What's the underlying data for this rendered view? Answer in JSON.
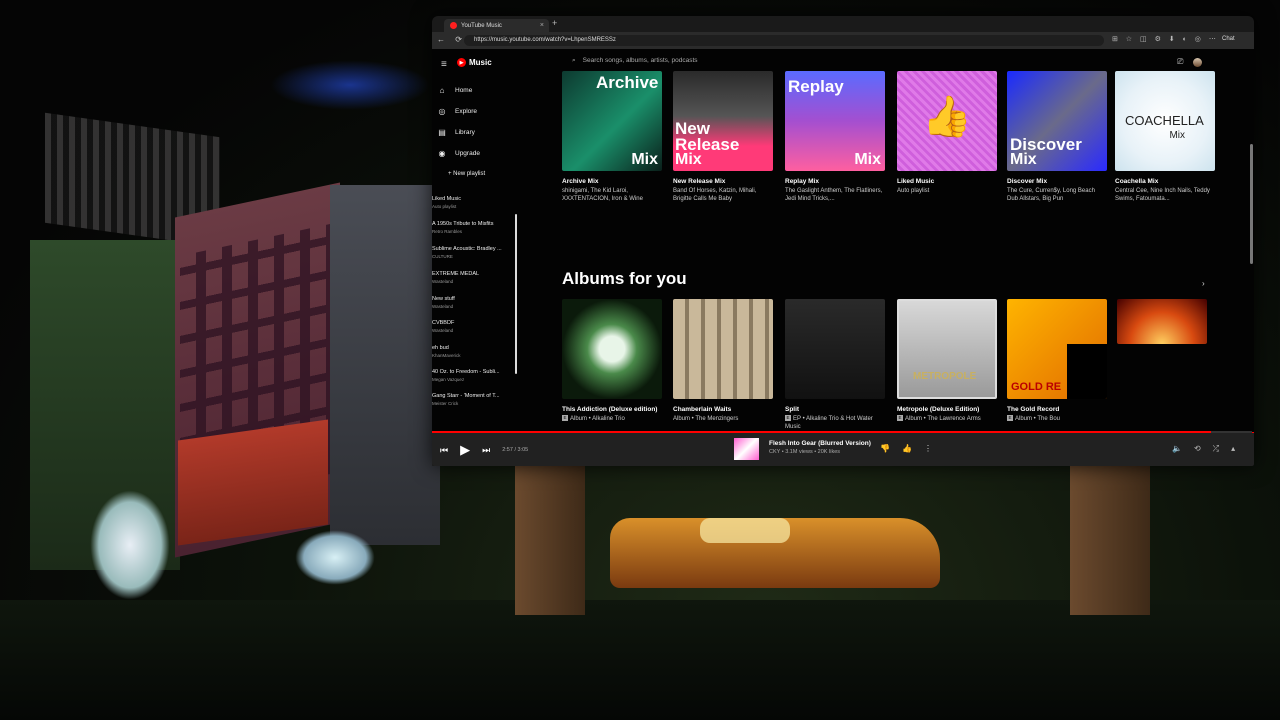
{
  "browser": {
    "tab_title": "YouTube Music",
    "tab_close": "×",
    "new_tab": "+",
    "nav_icons": "← ⟳",
    "url": "https://music.youtube.com/watch?v=LhpenSMRESSz",
    "ext_icons": "⊞ ☆ ◫ ⚙ ⬇ ◐ ◎ ⋯",
    "chat_label": "Chat"
  },
  "app": {
    "logo_text": "Music",
    "hamburger": "≡",
    "search_icon": "⌕",
    "search_placeholder": "Search songs, albums, artists, podcasts",
    "cast_icon": "⎚",
    "nav": [
      {
        "label": "Home",
        "icon": "⌂"
      },
      {
        "label": "Explore",
        "icon": "◎"
      },
      {
        "label": "Library",
        "icon": "▤"
      },
      {
        "label": "Upgrade",
        "icon": "◉"
      }
    ],
    "new_playlist": "+ New playlist",
    "playlists": [
      {
        "title": "Liked Music",
        "sub": "Auto playlist"
      },
      {
        "title": "A 1950s Tribute to Misfits",
        "sub": "Retro Rambles"
      },
      {
        "title": "Sublime Acoustic: Bradley ...",
        "sub": "CULTURE"
      },
      {
        "title": "EXTREME MEDAL",
        "sub": "Wasteland"
      },
      {
        "title": "New stuff",
        "sub": "Wasteland"
      },
      {
        "title": "CVBBDF",
        "sub": "Wasteland"
      },
      {
        "title": "eh bud",
        "sub": "KhanMaverick"
      },
      {
        "title": "40 Oz. to Freedom - Subli...",
        "sub": "Megan Vazquez"
      },
      {
        "title": "Gang Starr - 'Moment of T...",
        "sub": "Meister Crick"
      }
    ],
    "mixes": [
      {
        "title": "Archive Mix",
        "sub": "shinigami, The Kid Laroi, XXXTENTACION, Iron & Wine",
        "big": "Archive",
        "small": "Mix"
      },
      {
        "title": "New Release Mix",
        "sub": "Band Of Horses, Katzin, Mihali, Brigitte Calls Me Baby",
        "big": "New Release",
        "small": "Mix"
      },
      {
        "title": "Replay Mix",
        "sub": "The Gaslight Anthem, The Flatliners, Jedi Mind Tricks,...",
        "big": "Replay",
        "small": "Mix"
      },
      {
        "title": "Liked Music",
        "sub": "Auto playlist",
        "big": "👍",
        "small": ""
      },
      {
        "title": "Discover Mix",
        "sub": "The Cure, Curren$y, Long Beach Dub Allstars, Big Pun",
        "big": "Discover",
        "small": "Mix"
      },
      {
        "title": "Coachella Mix",
        "sub": "Central Cee, Nine Inch Nails, Teddy Swims, Fatoumata...",
        "big": "COACHELLA",
        "small": "Mix"
      }
    ],
    "albums_title": "Albums for you",
    "albums_arrow": "›",
    "albums": [
      {
        "title": "This Addiction (Deluxe edition)",
        "sub": "Album • Alkaline Trio",
        "explicit": "E"
      },
      {
        "title": "Chamberlain Waits",
        "sub": "Album • The Menzingers",
        "explicit": ""
      },
      {
        "title": "Split",
        "sub": "EP • Alkaline Trio & Hot Water Music",
        "explicit": "E"
      },
      {
        "title": "Metropole (Deluxe Edition)",
        "sub": "Album • The Lawrence Arms",
        "explicit": "E"
      },
      {
        "title": "The Gold Record",
        "sub": "Album • The Bou",
        "explicit": "E"
      }
    ],
    "album_art_text": {
      "metropole": "METROPOLE",
      "gold": "GOLD RE"
    }
  },
  "player": {
    "prev": "⏮",
    "play": "▶",
    "next": "⏭",
    "time": "2:57 / 3:05",
    "progress": 0.95,
    "title": "Flesh Into Gear (Blurred Version)",
    "sub": "CKY • 3.1M views • 20K likes",
    "dislike": "👎",
    "like": "👍",
    "more": "⋮",
    "right_icons": [
      "🔈",
      "⟲",
      "⤮",
      "▴"
    ]
  }
}
